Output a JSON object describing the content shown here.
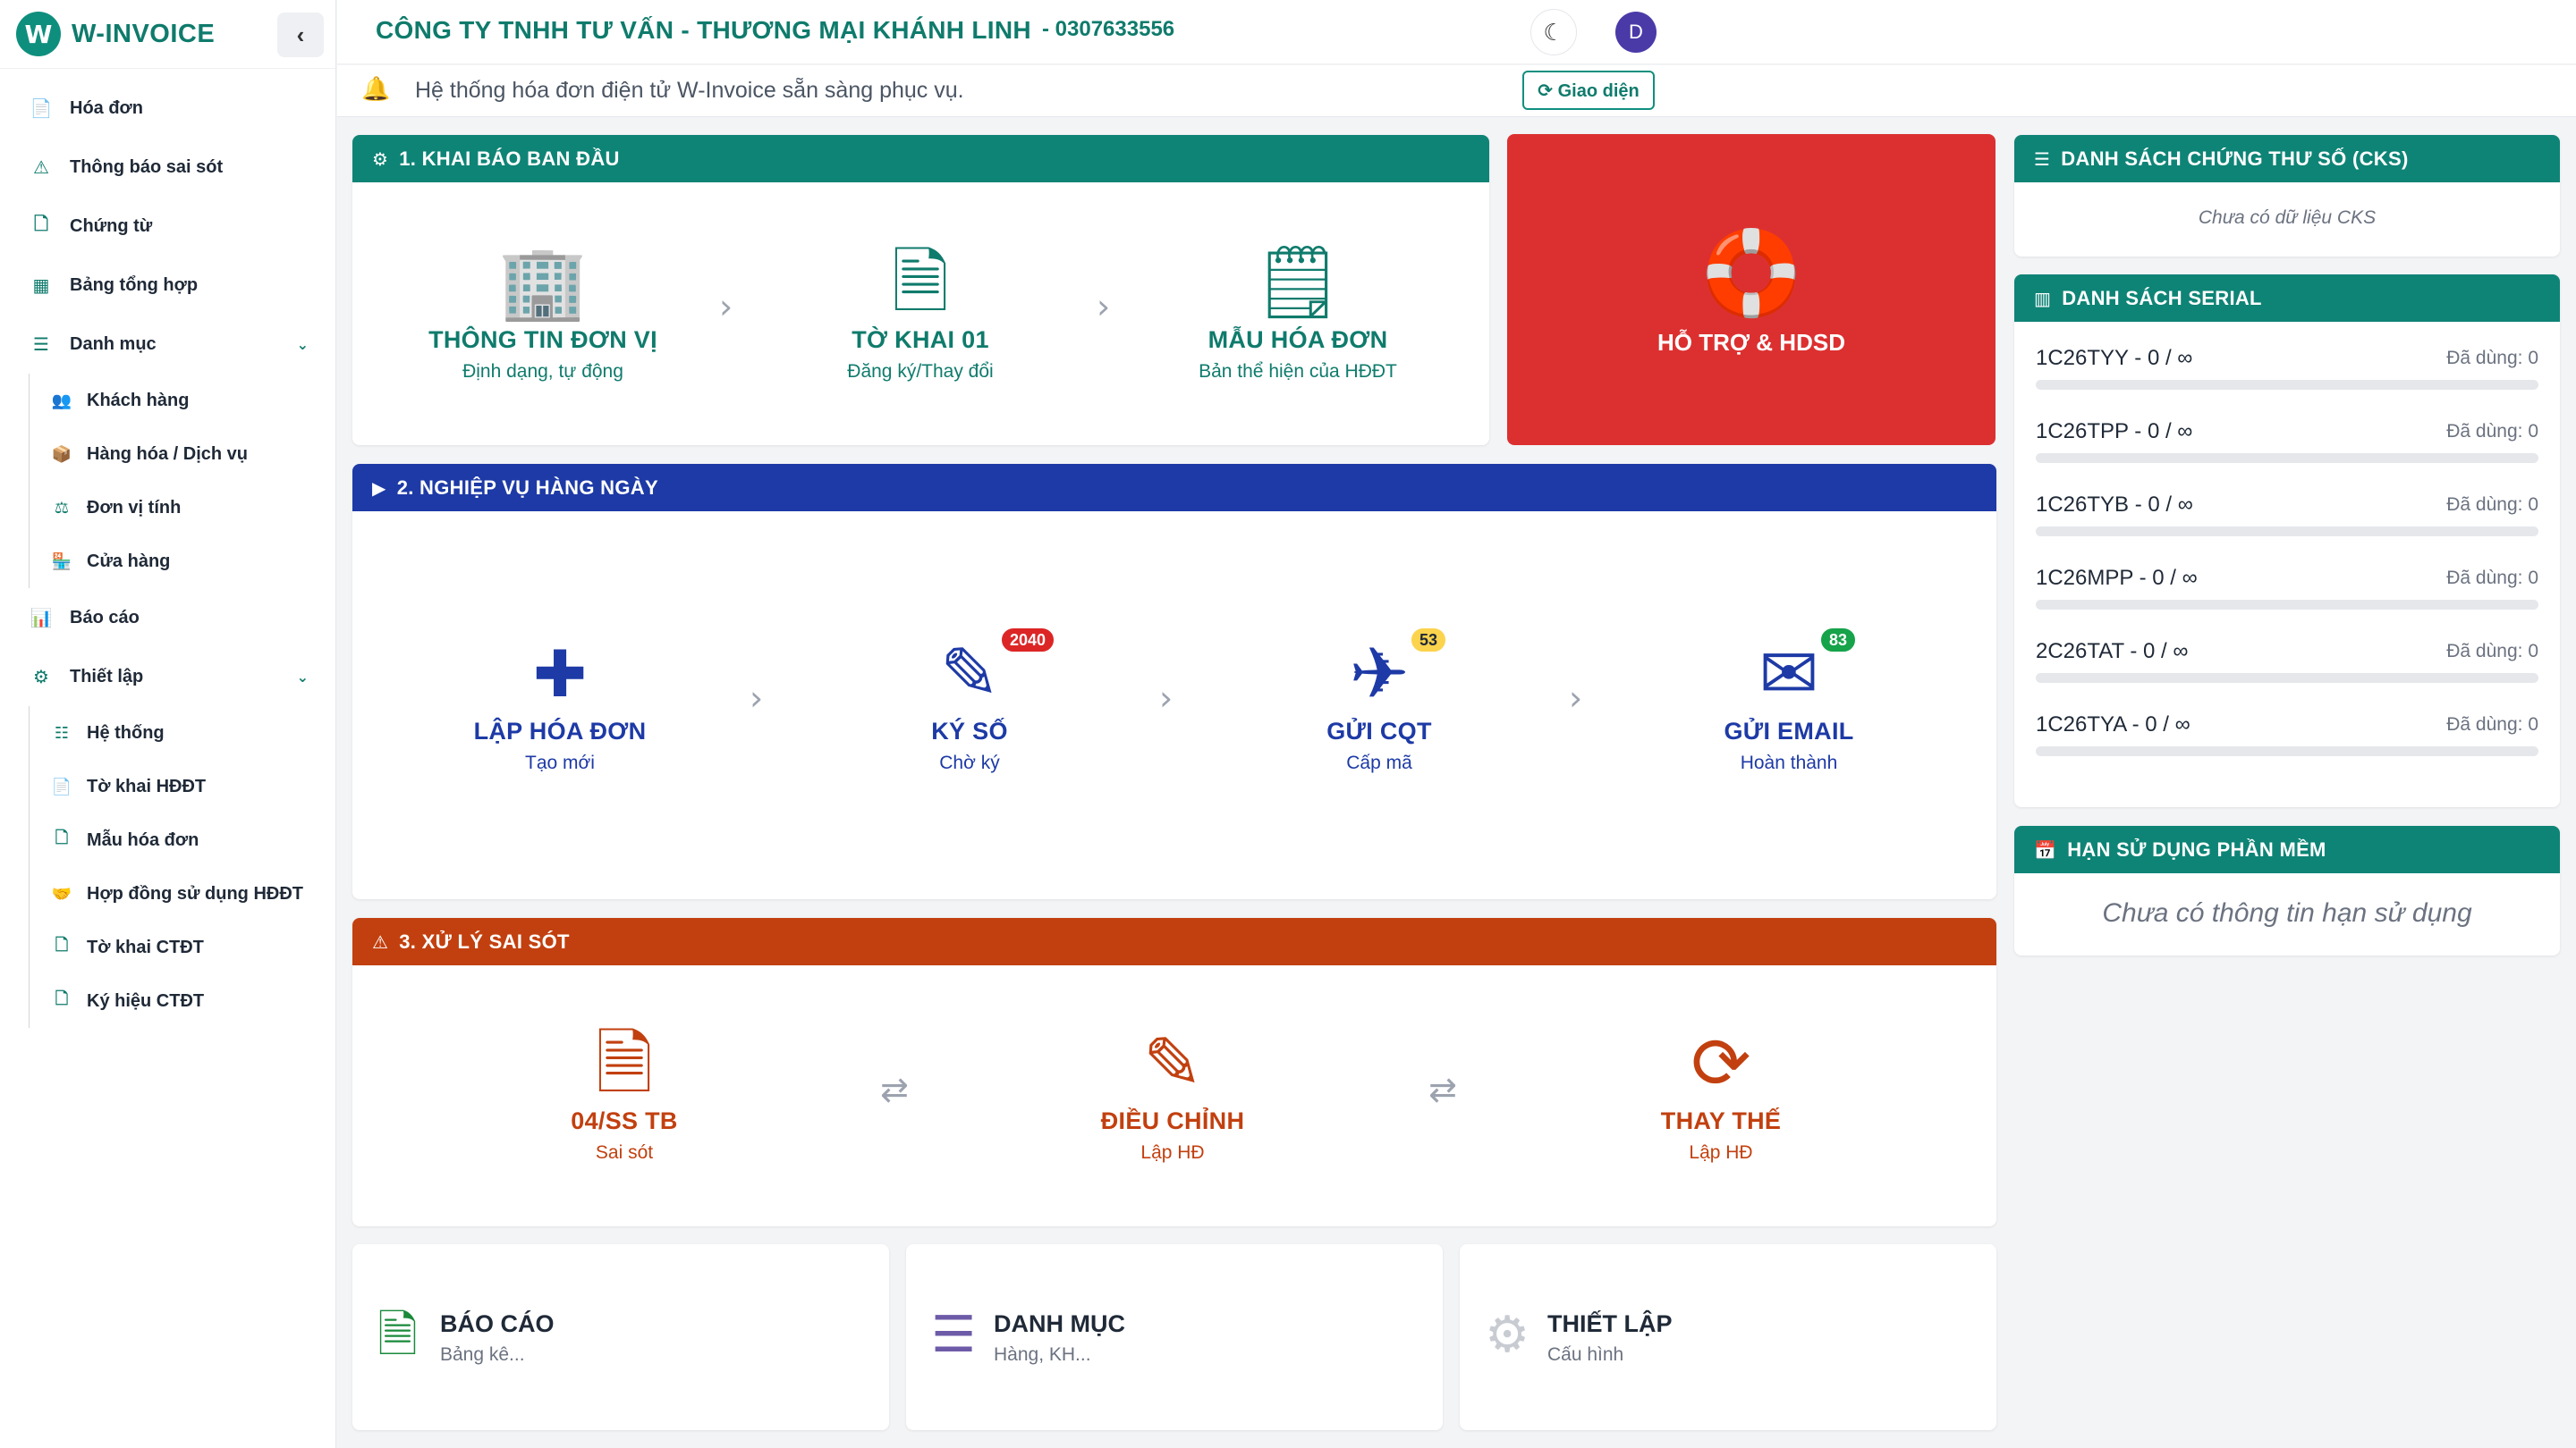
{
  "brand": {
    "name": "W-INVOICE",
    "logo_letter": "W",
    "collapse_icon": "‹"
  },
  "sidebar": {
    "items": [
      {
        "label": "Hóa đơn",
        "icon": "📄"
      },
      {
        "label": "Thông báo sai sót",
        "icon": "⚠"
      },
      {
        "label": "Chứng từ",
        "icon": "🗋"
      },
      {
        "label": "Bảng tổng hợp",
        "icon": "▦"
      },
      {
        "label": "Danh mục",
        "icon": "☰",
        "chevron": "⌄"
      }
    ],
    "danh_muc_sub": [
      {
        "label": "Khách hàng",
        "icon": "👥"
      },
      {
        "label": "Hàng hóa / Dịch vụ",
        "icon": "📦"
      },
      {
        "label": "Đơn vị tính",
        "icon": "⚖"
      },
      {
        "label": "Cửa hàng",
        "icon": "🏪"
      }
    ],
    "items2": [
      {
        "label": "Báo cáo",
        "icon": "📊"
      },
      {
        "label": "Thiết lập",
        "icon": "⚙",
        "chevron": "⌄"
      }
    ],
    "thiet_lap_sub": [
      {
        "label": "Hệ thống",
        "icon": "☷"
      },
      {
        "label": "Tờ khai HĐĐT",
        "icon": "📄"
      },
      {
        "label": "Mẫu hóa đơn",
        "icon": "🗋"
      },
      {
        "label": "Hợp đồng sử dụng HĐĐT",
        "icon": "🤝"
      },
      {
        "label": "Tờ khai CTĐT",
        "icon": "🗋"
      },
      {
        "label": "Ký hiệu CTĐT",
        "icon": "🗋"
      }
    ]
  },
  "topbar": {
    "company": "CÔNG TY TNHH TƯ VẤN - THƯƠNG MẠI KHÁNH LINH",
    "tax_id": "- 0307633556",
    "moon_icon": "☾",
    "avatar": "D"
  },
  "notice": {
    "icon": "🔔",
    "text": "Hệ thống hóa đơn điện tử W-Invoice sẵn sàng phục vụ.",
    "button": "⟳ Giao diện"
  },
  "section1": {
    "title": "1. KHAI BÁO BAN ĐẦU",
    "icon": "⚙",
    "steps": [
      {
        "icon": "🏢",
        "title": "THÔNG TIN ĐƠN VỊ",
        "sub": "Định dạng, tự động"
      },
      {
        "icon": "🗎",
        "title": "TỜ KHAI 01",
        "sub": "Đăng ký/Thay đổi"
      },
      {
        "icon": "🗒",
        "title": "MẪU HÓA ĐƠN",
        "sub": "Bản thể hiện của HĐĐT"
      }
    ],
    "arrow": "›"
  },
  "support": {
    "icon": "🛟",
    "title": "HỖ TRỢ & HDSD"
  },
  "section2": {
    "title": "2. NGHIỆP VỤ HÀNG NGÀY",
    "icon": "▶",
    "steps": [
      {
        "icon": "✚",
        "title": "LẬP HÓA ĐƠN",
        "sub": "Tạo mới"
      },
      {
        "icon": "✎",
        "title": "KÝ SỐ",
        "sub": "Chờ ký",
        "badge": "2040"
      },
      {
        "icon": "✈",
        "title": "GỬI CQT",
        "sub": "Cấp mã",
        "badge": "53"
      },
      {
        "icon": "✉",
        "title": "GỬI EMAIL",
        "sub": "Hoàn thành",
        "badge": "83"
      }
    ],
    "arrow": "›"
  },
  "section3": {
    "title": "3. XỬ LÝ SAI SÓT",
    "icon": "⚠",
    "steps": [
      {
        "icon": "🗎",
        "title": "04/SS TB",
        "sub": "Sai sót"
      },
      {
        "icon": "✎",
        "title": "ĐIỀU CHỈNH",
        "sub": "Lập HĐ"
      },
      {
        "icon": "⟳",
        "title": "THAY THẾ",
        "sub": "Lập HĐ"
      }
    ],
    "arrow": "⇄"
  },
  "quick": [
    {
      "icon": "🗎",
      "title": "BÁO CÁO",
      "sub": "Bảng kê..."
    },
    {
      "icon": "☰",
      "title": "DANH MỤC",
      "sub": "Hàng, KH..."
    },
    {
      "icon": "⚙",
      "title": "THIẾT LẬP",
      "sub": "Cấu hình"
    }
  ],
  "cks": {
    "title": "DANH SÁCH CHỨNG THƯ SỐ (CKS)",
    "icon": "☰",
    "empty": "Chưa có dữ liệu CKS"
  },
  "serial": {
    "title": "DANH SÁCH SERIAL",
    "icon": "▥",
    "rows": [
      {
        "name": "1C26TYY - 0 / ∞",
        "used": "Đã dùng: 0",
        "progress": 0
      },
      {
        "name": "1C26TPP - 0 / ∞",
        "used": "Đã dùng: 0",
        "progress": 0
      },
      {
        "name": "1C26TYB - 0 / ∞",
        "used": "Đã dùng: 0",
        "progress": 0
      },
      {
        "name": "1C26MPP - 0 / ∞",
        "used": "Đã dùng: 0",
        "progress": 0
      },
      {
        "name": "2C26TAT - 0 / ∞",
        "used": "Đã dùng: 0",
        "progress": 0
      },
      {
        "name": "1C26TYA - 0 / ∞",
        "used": "Đã dùng: 0",
        "progress": 0
      }
    ]
  },
  "license": {
    "title": "HẠN SỬ DỤNG PHẦN MỀM",
    "icon": "📅",
    "empty": "Chưa có thông tin hạn sử dụng"
  },
  "colors": {
    "teal": "#0e8476",
    "navy": "#1d3aa6",
    "rust": "#c2400f",
    "red": "#dc3030"
  }
}
